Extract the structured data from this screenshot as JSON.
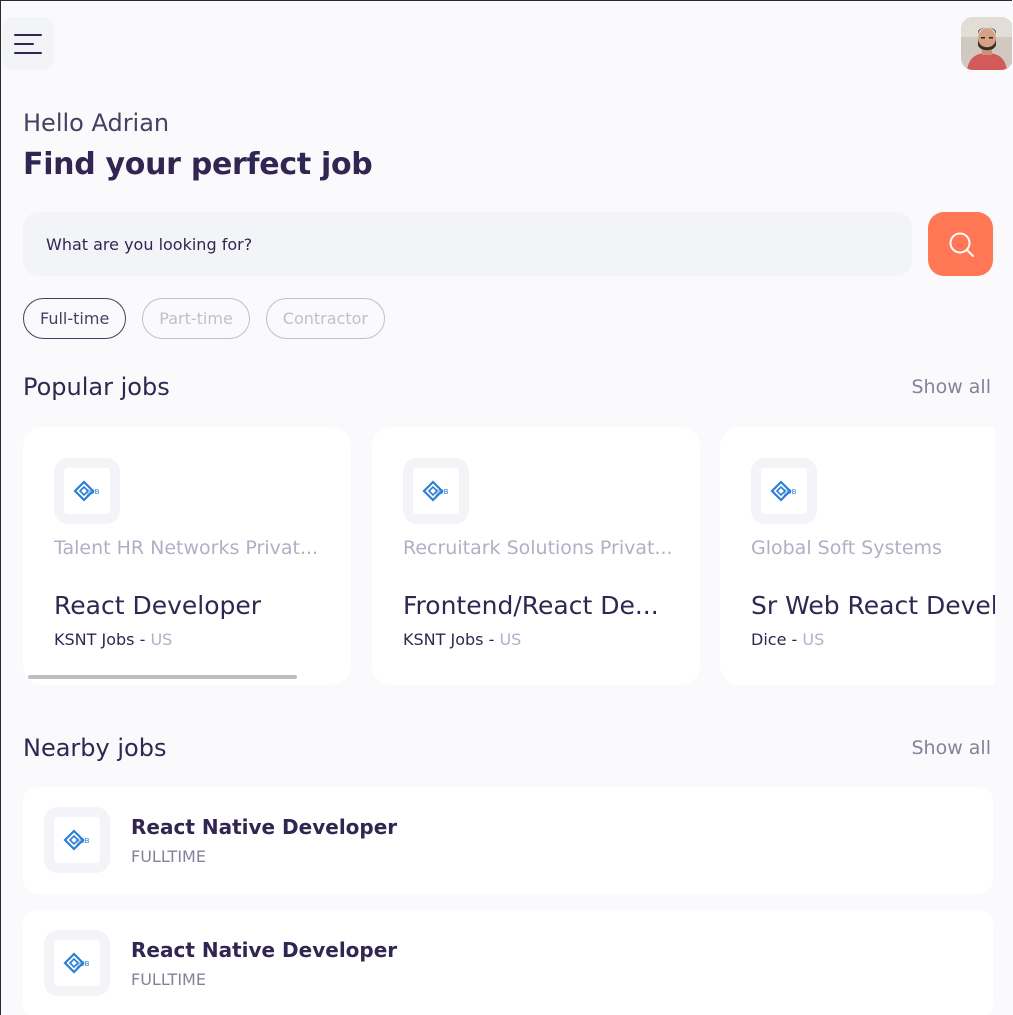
{
  "header": {
    "menu_icon": "hamburger-menu-icon",
    "avatar_icon": "user-profile-photo"
  },
  "welcome": {
    "greeting": "Hello Adrian",
    "headline": "Find your perfect job"
  },
  "search": {
    "placeholder": "What are you looking for?",
    "button_icon": "search-icon",
    "accent_color": "#FF7754"
  },
  "job_types": [
    {
      "label": "Full-time",
      "active": true
    },
    {
      "label": "Part-time",
      "active": false
    },
    {
      "label": "Contractor",
      "active": false
    }
  ],
  "popular": {
    "title": "Popular jobs",
    "show_all": "Show all",
    "jobs": [
      {
        "company": "Talent HR Networks Privat...",
        "title": "React Developer",
        "publisher": "KSNT Jobs",
        "separator": " - ",
        "country": "US",
        "logo": "job-logo-icon"
      },
      {
        "company": "Recruitark Solutions Privat...",
        "title": "Frontend/React De...",
        "publisher": "KSNT Jobs",
        "separator": " - ",
        "country": "US",
        "logo": "job-logo-icon"
      },
      {
        "company": "Global Soft Systems",
        "title": "Sr Web React Devel",
        "publisher": "Dice",
        "separator": " - ",
        "country": "US",
        "logo": "job-logo-icon"
      }
    ]
  },
  "nearby": {
    "title": "Nearby jobs",
    "show_all": "Show all",
    "jobs": [
      {
        "title": "React Native Developer",
        "type": "FULLTIME",
        "logo": "job-logo-icon"
      },
      {
        "title": "React Native Developer",
        "type": "FULLTIME",
        "logo": "job-logo-icon"
      }
    ]
  }
}
